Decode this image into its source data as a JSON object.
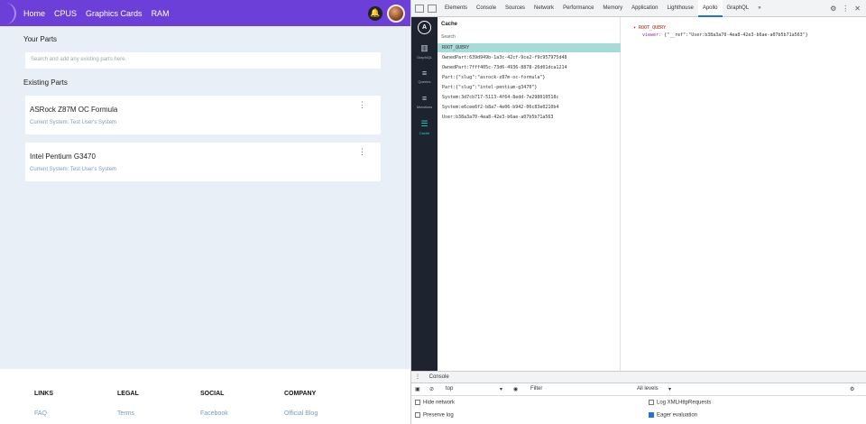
{
  "nav": {
    "links": [
      "Home",
      "CPUS",
      "Graphics Cards",
      "RAM"
    ]
  },
  "main": {
    "your_parts_title": "Your Parts",
    "search_placeholder": "Search and add any existing parts here.",
    "existing_parts_title": "Existing Parts",
    "parts": [
      {
        "name": "ASRock Z87M OC Formula",
        "system": "Current System: Test User's System"
      },
      {
        "name": "Intel Pentium G3470",
        "system": "Current System: Test User's System"
      }
    ]
  },
  "footer": {
    "columns": [
      {
        "heading": "LINKS",
        "link": "FAQ"
      },
      {
        "heading": "LEGAL",
        "link": "Terms"
      },
      {
        "heading": "SOCIAL",
        "link": "Facebook"
      },
      {
        "heading": "COMPANY",
        "link": "Official Blog"
      }
    ]
  },
  "devtools": {
    "tabs": [
      "Elements",
      "Console",
      "Sources",
      "Network",
      "Performance",
      "Memory",
      "Application",
      "Lighthouse",
      "Apollo",
      "GraphQL"
    ],
    "active_tab": "Apollo",
    "more_tabs": "»",
    "apollo": {
      "logo": "A",
      "rail": [
        {
          "label": "GraphiQL",
          "icon": "book-icon"
        },
        {
          "label": "Queries",
          "icon": "list-icon"
        },
        {
          "label": "Mutations",
          "icon": "list-icon"
        },
        {
          "label": "Cache",
          "icon": "database-icon"
        }
      ],
      "active_rail": "Cache",
      "cache_title": "Cache",
      "cache_search_placeholder": "Search",
      "cache_entries": [
        "ROOT_QUERY",
        "OwnedPart:639d949b-1a3c-42cf-9ce2-f9c957975d48",
        "OwnedPart:7fff405c-73d6-4936-8878-26d01dca1214",
        "Part:{\"slug\":\"asrock-z87m-oc-formula\"}",
        "Part:{\"slug\":\"intel-pentium-g3470\"}",
        "System:3d7cb717-5113-4f64-8edd-7e298010518c",
        "System:e6cee6f2-b8a7-4e06-b942-06c83e0210b4",
        "User:b38a3a70-4ea8-42e3-b6ae-a07b5b71a563"
      ],
      "selected_entry": "ROOT_QUERY",
      "detail": {
        "root": "ROOT_QUERY",
        "viewer_key": "viewer:",
        "viewer_value": "{\"__ref\":\"User:b38a3a70-4ea8-42e3-b6ae-a07b5b71a563\"}"
      }
    },
    "console": {
      "title": "Console",
      "context": "top",
      "filter_placeholder": "Filter",
      "levels": "All levels",
      "options": [
        {
          "label": "Hide network",
          "checked": false
        },
        {
          "label": "Log XMLHttpRequests",
          "checked": false
        },
        {
          "label": "Preserve log",
          "checked": false
        },
        {
          "label": "Eager evaluation",
          "checked": true
        }
      ]
    }
  },
  "colors": {
    "nav_bg": "#6c3fd8",
    "app_bg": "#e9eff6",
    "apollo_rail_bg": "#1d2430",
    "cache_selected": "#a6dcd8",
    "accent_teal": "#2fd2c4"
  }
}
